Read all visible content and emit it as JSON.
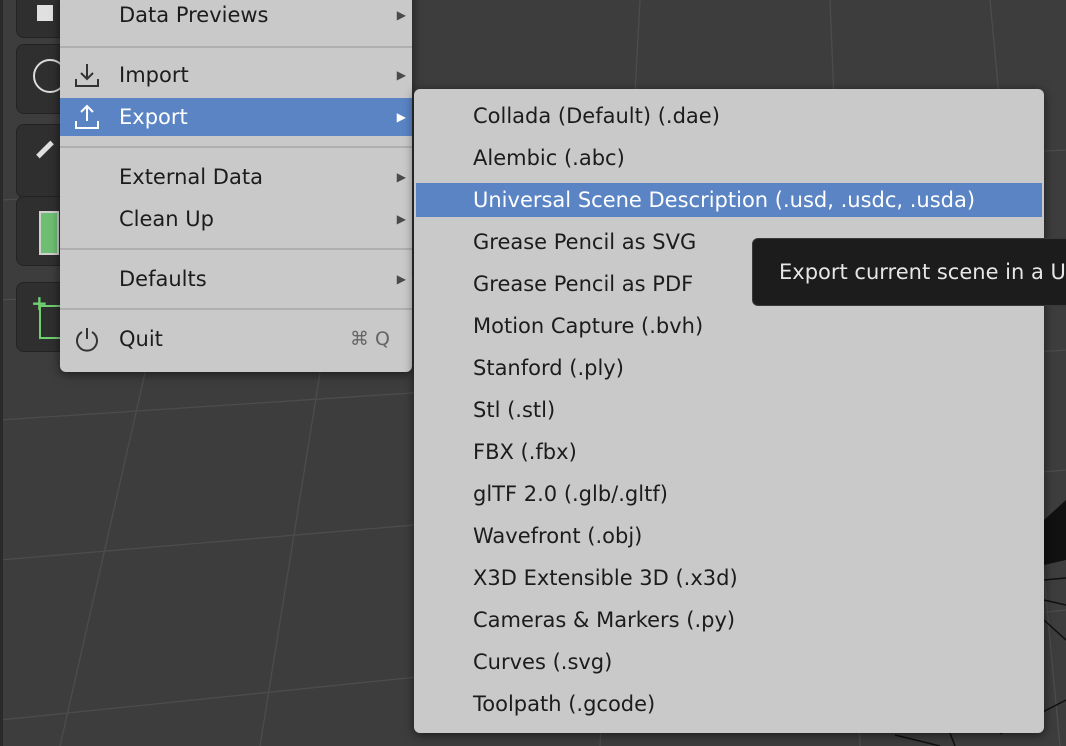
{
  "file_menu": {
    "items": [
      {
        "label": "Data Previews",
        "has_submenu": true
      },
      {
        "label": "Import",
        "icon": "import-icon",
        "has_submenu": true
      },
      {
        "label": "Export",
        "icon": "export-icon",
        "has_submenu": true,
        "active": true
      },
      {
        "label": "External Data",
        "has_submenu": true
      },
      {
        "label": "Clean Up",
        "has_submenu": true
      },
      {
        "label": "Defaults",
        "has_submenu": true
      },
      {
        "label": "Quit",
        "icon": "power-icon",
        "shortcut": "⌘ Q"
      }
    ]
  },
  "export_submenu": {
    "items": [
      {
        "label": "Collada (Default) (.dae)"
      },
      {
        "label": "Alembic (.abc)"
      },
      {
        "label": "Universal Scene Description (.usd, .usdc, .usda)",
        "active": true
      },
      {
        "label": "Grease Pencil as SVG"
      },
      {
        "label": "Grease Pencil as PDF"
      },
      {
        "label": "Motion Capture (.bvh)"
      },
      {
        "label": "Stanford (.ply)"
      },
      {
        "label": "Stl (.stl)"
      },
      {
        "label": "FBX (.fbx)"
      },
      {
        "label": "glTF 2.0 (.glb/.gltf)"
      },
      {
        "label": "Wavefront (.obj)"
      },
      {
        "label": "X3D Extensible 3D (.x3d)"
      },
      {
        "label": "Cameras & Markers (.py)"
      },
      {
        "label": "Curves (.svg)"
      },
      {
        "label": "Toolpath (.gcode)"
      }
    ]
  },
  "tooltip": {
    "text": "Export current scene in a U"
  },
  "colors": {
    "menu_bg": "#c9c9c9",
    "highlight": "#5a84c4",
    "viewport_bg": "#3d3d3d",
    "tooltip_bg": "#1c1c1c"
  },
  "toolbar": {
    "icons": [
      "select-box-icon",
      "transform-icon",
      "annotate-icon",
      "measure-icon",
      "add-cube-icon"
    ]
  }
}
